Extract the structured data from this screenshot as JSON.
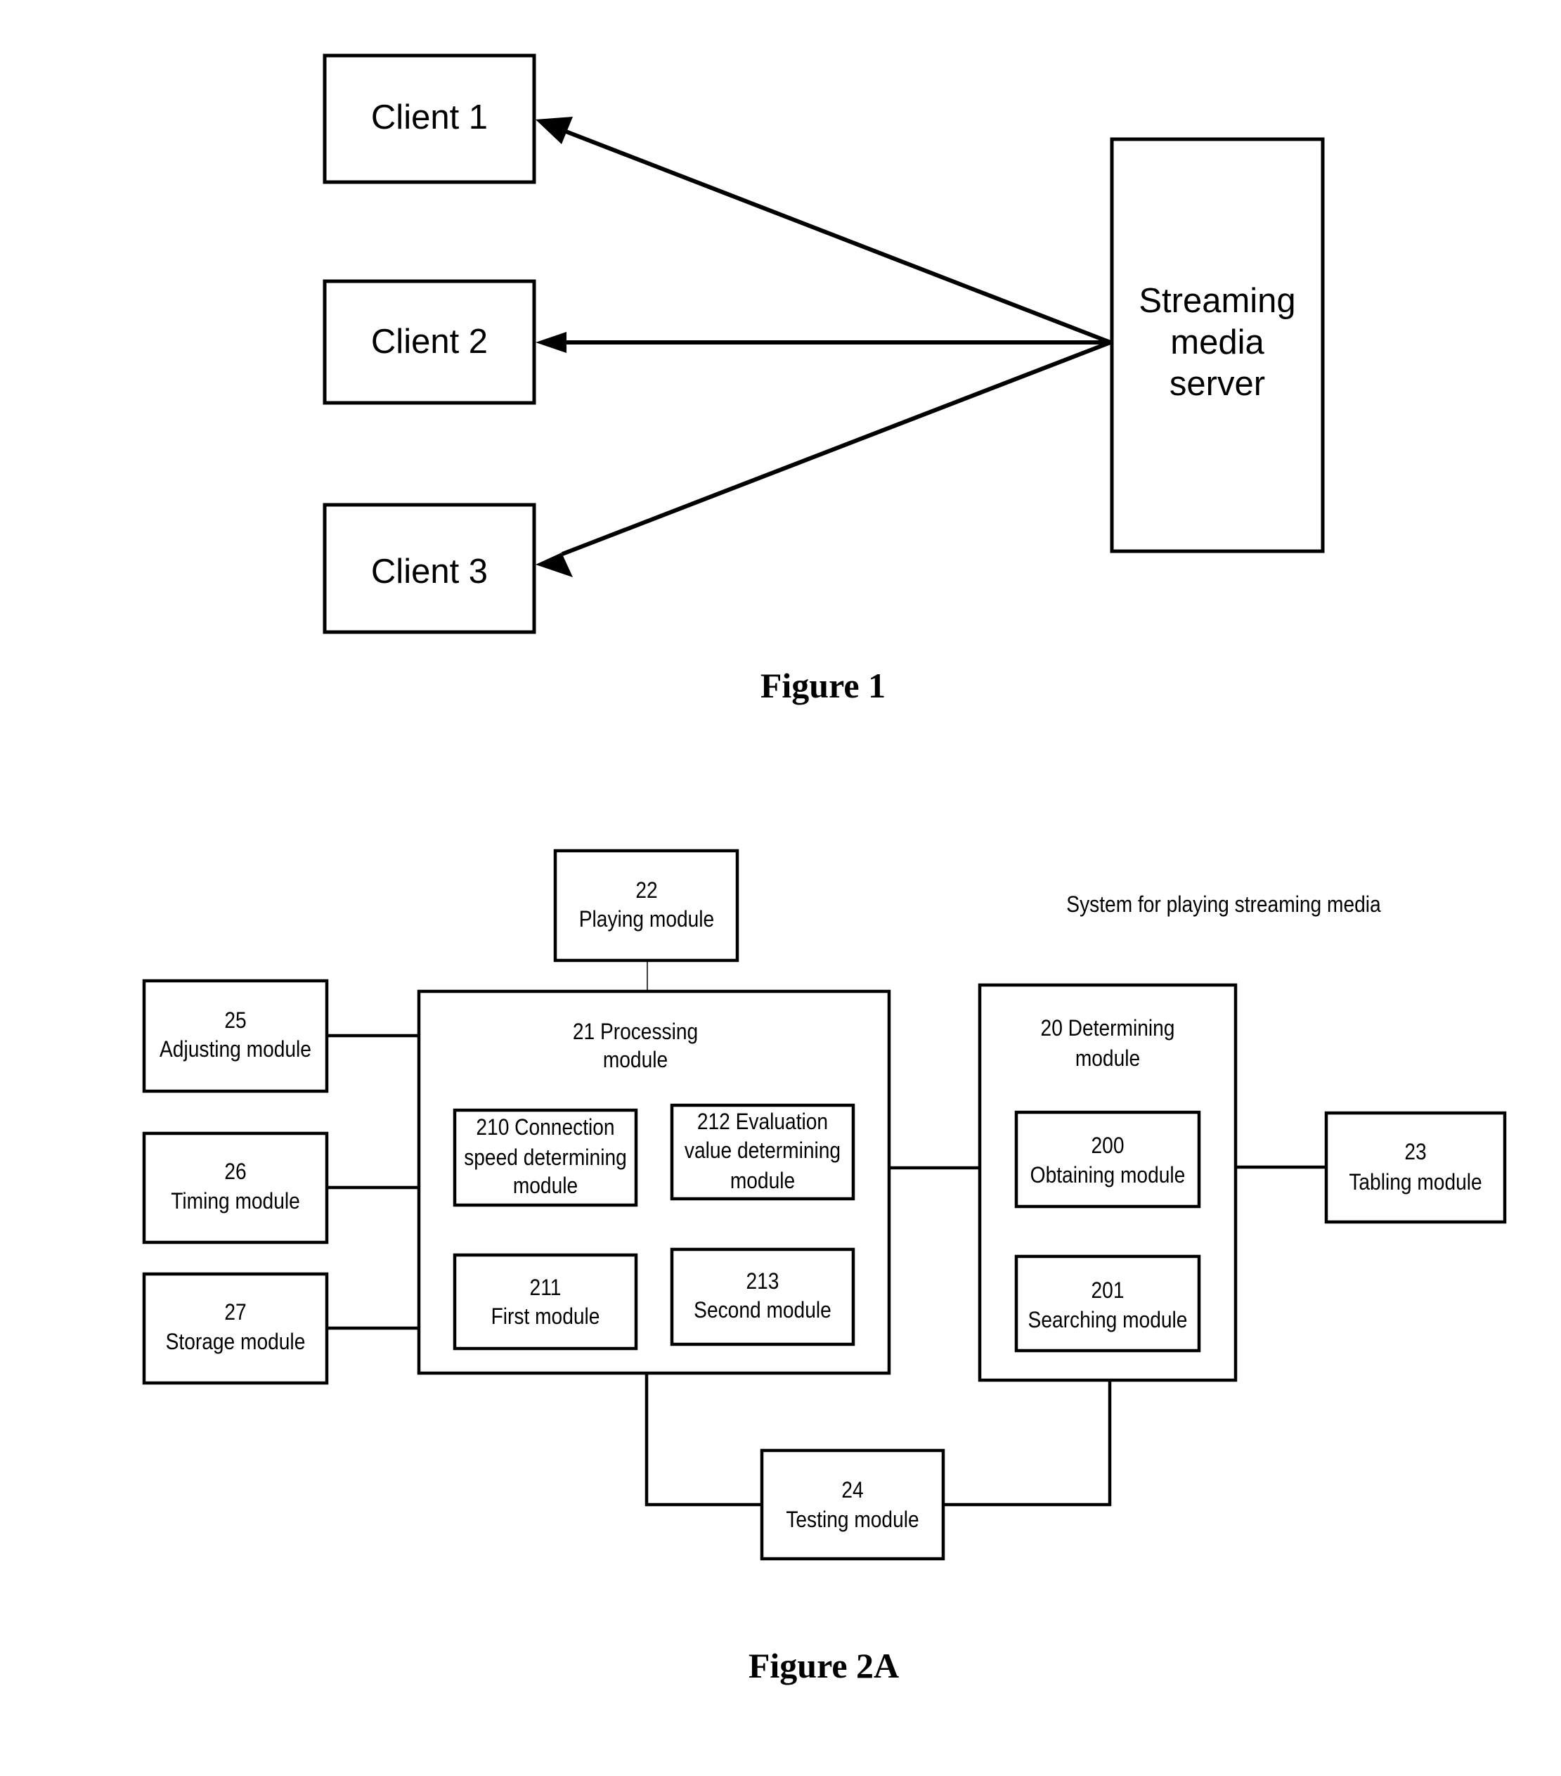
{
  "figure1": {
    "caption": "Figure 1",
    "server": {
      "label_lines": [
        "Streaming",
        "media",
        "server"
      ]
    },
    "clients": [
      {
        "label": "Client 1"
      },
      {
        "label": "Client 2"
      },
      {
        "label": "Client 3"
      }
    ],
    "edges": [
      {
        "from": "Streaming media server",
        "to": "Client 1",
        "type": "arrow"
      },
      {
        "from": "Streaming media server",
        "to": "Client 2",
        "type": "arrow"
      },
      {
        "from": "Streaming media server",
        "to": "Client 3",
        "type": "arrow"
      }
    ]
  },
  "figure2a": {
    "caption": "Figure 2A",
    "system_label": "System for playing streaming media",
    "modules": {
      "m22": {
        "lines": [
          "22",
          "Playing module"
        ]
      },
      "m25": {
        "lines": [
          "25",
          "Adjusting module"
        ]
      },
      "m26": {
        "lines": [
          "26",
          "Timing module"
        ]
      },
      "m27": {
        "lines": [
          "27",
          "Storage module"
        ]
      },
      "m21": {
        "lines": [
          "21 Processing",
          "module"
        ]
      },
      "m210": {
        "lines": [
          "210 Connection",
          "speed determining",
          "module"
        ]
      },
      "m211": {
        "lines": [
          "211",
          "First module"
        ]
      },
      "m212": {
        "lines": [
          "212 Evaluation",
          "value determining",
          "module"
        ]
      },
      "m213": {
        "lines": [
          "213",
          "Second module"
        ]
      },
      "m20": {
        "lines": [
          "20 Determining",
          "module"
        ]
      },
      "m200": {
        "lines": [
          "200",
          "Obtaining module"
        ]
      },
      "m201": {
        "lines": [
          "201",
          "Searching module"
        ]
      },
      "m23": {
        "lines": [
          "23",
          "Tabling module"
        ]
      },
      "m24": {
        "lines": [
          "24",
          "Testing module"
        ]
      }
    },
    "edges": [
      {
        "from": "22 Playing module",
        "to": "21 Processing module"
      },
      {
        "from": "25 Adjusting module",
        "to": "21 Processing module"
      },
      {
        "from": "26 Timing module",
        "to": "21 Processing module"
      },
      {
        "from": "27 Storage module",
        "to": "21 Processing module"
      },
      {
        "from": "210 Connection speed determining module",
        "to": "211 First module"
      },
      {
        "from": "212 Evaluation value determining module",
        "to": "213 Second module"
      },
      {
        "from": "21 Processing module",
        "to": "20 Determining module"
      },
      {
        "from": "200 Obtaining module",
        "to": "201 Searching module"
      },
      {
        "from": "20 Determining module",
        "to": "23 Tabling module"
      },
      {
        "from": "21 Processing module",
        "to": "24 Testing module"
      },
      {
        "from": "20 Determining module",
        "to": "24 Testing module"
      }
    ]
  }
}
